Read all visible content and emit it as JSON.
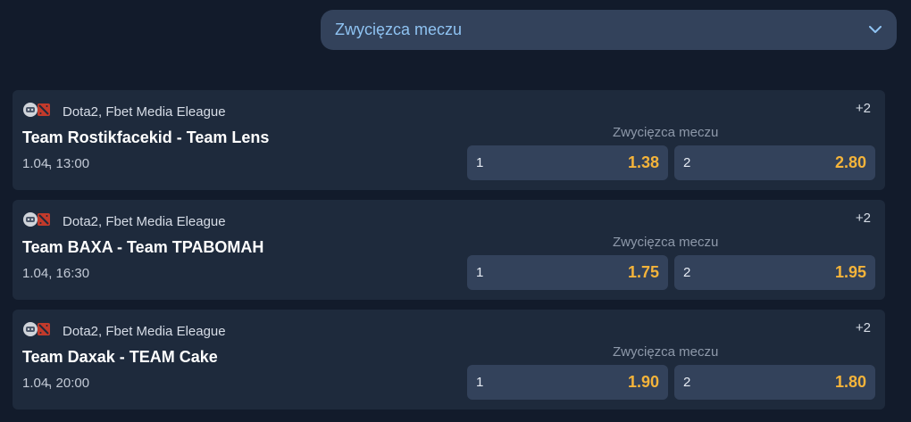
{
  "market_selector": {
    "label": "Zwycięzca meczu",
    "icon": "chevron-down-icon"
  },
  "events": [
    {
      "league": "Dota2, Fbet Media Eleague",
      "teams": "Team Rostikfacekid - Team Lens",
      "datetime": "1.04̵, 13:00",
      "more_count": "+2",
      "market_name": "Zwycięzca meczu",
      "odds": [
        {
          "outcome": "1",
          "price": "1.38"
        },
        {
          "outcome": "2",
          "price": "2.80"
        }
      ]
    },
    {
      "league": "Dota2, Fbet Media Eleague",
      "teams": "Team BAXA - Team TPABOMAH",
      "datetime": "1.04, 16:30",
      "more_count": "+2",
      "market_name": "Zwycięzca meczu",
      "odds": [
        {
          "outcome": "1",
          "price": "1.75"
        },
        {
          "outcome": "2",
          "price": "1.95"
        }
      ]
    },
    {
      "league": "Dota2, Fbet Media Eleague",
      "teams": "Team Daxak - TEAM Cake",
      "datetime": "1.04̵, 20:00",
      "more_count": "+2",
      "market_name": "Zwycięzca meczu",
      "odds": [
        {
          "outcome": "1",
          "price": "1.90"
        },
        {
          "outcome": "2",
          "price": "1.80"
        }
      ]
    }
  ],
  "colors": {
    "background": "#121b2b",
    "card": "#1e2a3c",
    "button": "#33425b",
    "price": "#f5b43a",
    "selector_text": "#8fc3f2"
  }
}
